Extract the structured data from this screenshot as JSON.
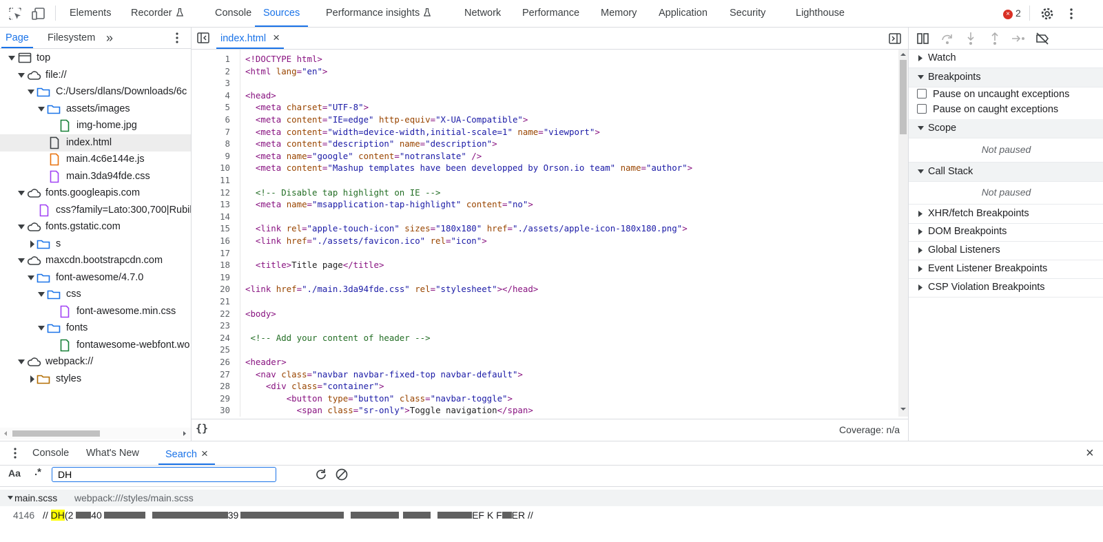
{
  "toolbar": {
    "tabs": [
      "Elements",
      "Recorder",
      "Console",
      "Sources",
      "Performance insights",
      "Network",
      "Performance",
      "Memory",
      "Application",
      "Security",
      "Lighthouse"
    ],
    "active_tab": "Sources",
    "error_count": "2",
    "error_dot": "×"
  },
  "navigator": {
    "tabs": [
      "Page",
      "Filesystem"
    ],
    "more": "»",
    "tree": [
      {
        "label": "top"
      },
      {
        "label": "file://"
      },
      {
        "label": "C:/Users/dlans/Downloads/6c"
      },
      {
        "label": "assets/images"
      },
      {
        "label": "img-home.jpg"
      },
      {
        "label": "index.html"
      },
      {
        "label": "main.4c6e144e.js"
      },
      {
        "label": "main.3da94fde.css"
      },
      {
        "label": "fonts.googleapis.com"
      },
      {
        "label": "css?family=Lato:300,700|Rubik"
      },
      {
        "label": "fonts.gstatic.com"
      },
      {
        "label": "s"
      },
      {
        "label": "maxcdn.bootstrapcdn.com"
      },
      {
        "label": "font-awesome/4.7.0"
      },
      {
        "label": "css"
      },
      {
        "label": "font-awesome.min.css"
      },
      {
        "label": "fonts"
      },
      {
        "label": "fontawesome-webfont.wo"
      },
      {
        "label": "webpack://"
      },
      {
        "label": "styles"
      }
    ]
  },
  "editor": {
    "open_file": "index.html",
    "close": "×",
    "coverage": "Coverage: n/a",
    "format_button": "{}",
    "line_numbers": [
      "1",
      "2",
      "3",
      "4",
      "5",
      "6",
      "7",
      "8",
      "9",
      "10",
      "11",
      "12",
      "13",
      "14",
      "15",
      "16",
      "17",
      "18",
      "19",
      "20",
      "21",
      "22",
      "23",
      "24",
      "25",
      "26",
      "27",
      "28",
      "29",
      "30"
    ]
  },
  "debugger": {
    "watch": "Watch",
    "breakpoints": "Breakpoints",
    "pause_uncaught": "Pause on uncaught exceptions",
    "pause_caught": "Pause on caught exceptions",
    "scope": "Scope",
    "scope_status": "Not paused",
    "call_stack": "Call Stack",
    "call_stack_status": "Not paused",
    "xhr": "XHR/fetch Breakpoints",
    "dom": "DOM Breakpoints",
    "global": "Global Listeners",
    "event": "Event Listener Breakpoints",
    "csp": "CSP Violation Breakpoints"
  },
  "drawer": {
    "tabs": [
      "Console",
      "What's New",
      "Search"
    ],
    "close": "×",
    "match_case": "Aa",
    "regex": ".*",
    "search_value": "DH",
    "result_file": "main.scss",
    "result_path": "webpack:///styles/main.scss",
    "result_line_number": "4146",
    "result_prefix": "//",
    "result_match": "DH",
    "result_tail_1": "(2",
    "result_tail_2": "40",
    "result_tail_3": "39",
    "result_tail_4": "EF",
    "result_tail_5": "K F",
    "result_tail_6": "ER //"
  }
}
